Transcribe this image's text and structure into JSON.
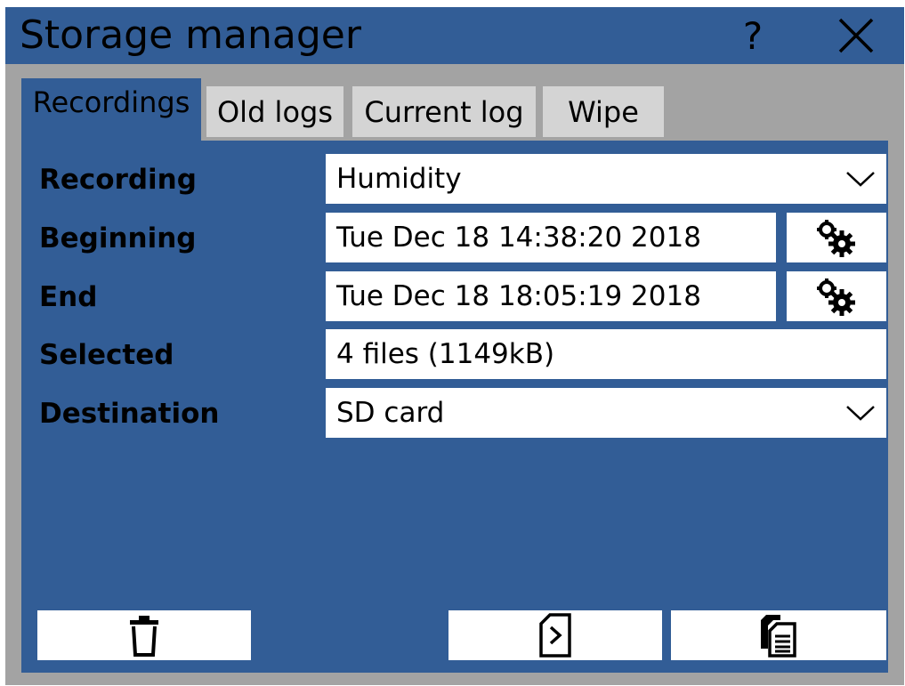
{
  "window": {
    "title": "Storage manager",
    "help_label": "?"
  },
  "tabs": [
    {
      "label": "Recordings",
      "active": true
    },
    {
      "label": "Old logs",
      "active": false
    },
    {
      "label": "Current log",
      "active": false
    },
    {
      "label": "Wipe",
      "active": false
    }
  ],
  "form": {
    "recording": {
      "label": "Recording",
      "value": "Humidity"
    },
    "beginning": {
      "label": "Beginning",
      "value": "Tue Dec 18 14:38:20 2018"
    },
    "end": {
      "label": "End",
      "value": "Tue Dec 18 18:05:19 2018"
    },
    "selected": {
      "label": "Selected",
      "value": "4 files (1149kB)"
    },
    "destination": {
      "label": "Destination",
      "value": "SD card"
    }
  },
  "icons": {
    "close": "close-icon",
    "gear": "gears-icon",
    "chevron": "chevron-down-icon",
    "delete": "trash-icon",
    "export": "sd-card-export-icon",
    "copy": "copy-files-icon"
  },
  "colors": {
    "panel": "#325d96",
    "frame": "#a3a3a3",
    "inactive_tab": "#d4d4d4"
  }
}
